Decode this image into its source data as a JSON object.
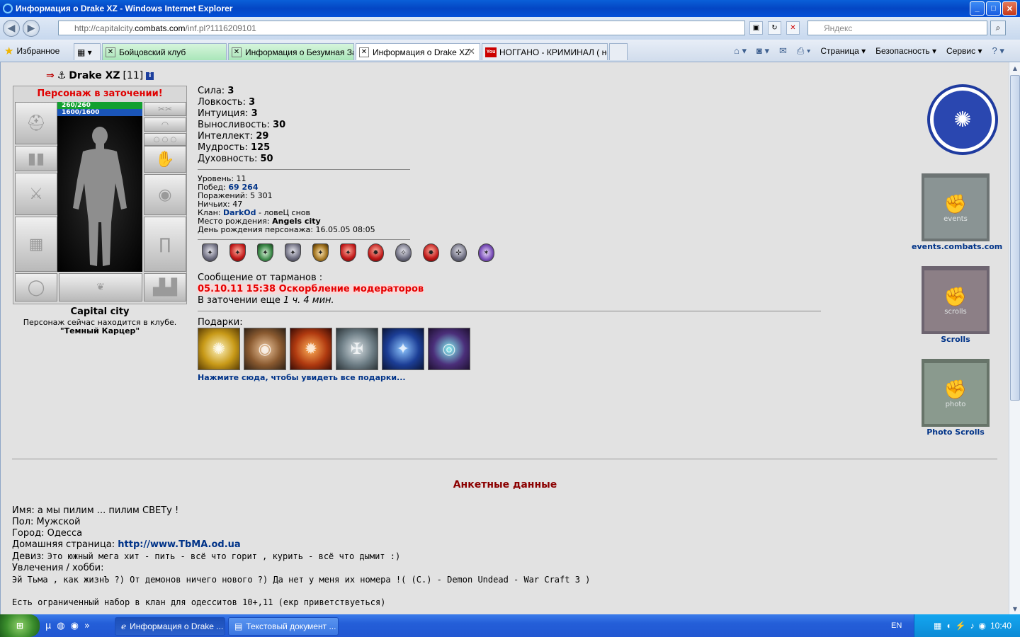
{
  "window": {
    "title": "Информация о Drake XZ - Windows Internet Explorer"
  },
  "address": {
    "url_prefix": "http://capitalcity.",
    "url_domain": "combats.com",
    "url_suffix": "/inf.pl?1116209101",
    "search_placeholder": "Яндекс"
  },
  "favorites_label": "Избранное",
  "tabs": [
    {
      "label": "Бойцовский клуб"
    },
    {
      "label": "Информация о Безумная Зая"
    },
    {
      "label": "Информация о Drake XZ"
    },
    {
      "label": "НОГГАНО - КРИМИНАЛ ( не..."
    }
  ],
  "commands": {
    "page": "Страница",
    "safety": "Безопасность",
    "service": "Сервис"
  },
  "character": {
    "name": "Drake XZ",
    "level_tag": "[11]",
    "prison_notice": "Персонаж в заточении!",
    "hp": "260/260",
    "mana": "1600/1600",
    "city": "Capital city",
    "location_note": "Персонаж сейчас находится в клубе.",
    "room": "\"Темный Карцер\""
  },
  "stats": [
    {
      "label": "Сила:",
      "value": "3"
    },
    {
      "label": "Ловкость:",
      "value": "3"
    },
    {
      "label": "Интуиция:",
      "value": "3"
    },
    {
      "label": "Выносливость:",
      "value": "30"
    },
    {
      "label": "Интеллект:",
      "value": "29"
    },
    {
      "label": "Мудрость:",
      "value": "125"
    },
    {
      "label": "Духовность:",
      "value": "50"
    }
  ],
  "info": {
    "level": "Уровень: 11",
    "wins_label": "Побед:",
    "wins": "69 264",
    "losses": "Поражений: 5 301",
    "draws": "Ничьих: 47",
    "clan_label": "Клан:",
    "clan": "DarkOd",
    "clan_rank": "- ловеЦ снов",
    "birthplace_label": "Место рождения:",
    "birthplace": "Angels city",
    "birthday": "День рождения персонажа: 16.05.05 08:05"
  },
  "message": {
    "title": "Сообщение от тарманов :",
    "text": "05.10.11 15:38 Оскорбление модераторов",
    "jail_prefix": "В заточении еще",
    "jail_time": "1 ч. 4 мин."
  },
  "gifts": {
    "label": "Подарки:",
    "link": "Нажмите сюда, чтобы увидеть все подарки..."
  },
  "sidebar": {
    "events_banner": "events",
    "events_link": "events.combats.com",
    "scrolls_banner": "scrolls",
    "scrolls_link": "Scrolls",
    "photo_banner": "photo",
    "photo_link": "Photo Scrolls"
  },
  "profile": {
    "heading": "Анкетные данные",
    "name": "Имя: а мы пилим ... пилим СВЕТу !",
    "gender": "Пол: Мужской",
    "city": "Город: Одесса",
    "homepage_label": "Домашняя страница:",
    "homepage": "http://www.TbMA.od.ua",
    "motto_label": "Девиз:",
    "motto": "Это южный мега хит - пить - всё что горит , курить - всё что дымит :)",
    "hobby_label": "Увлечения / хобби:",
    "hobby_1": "Эй Тьма , как жизнЪ ?) От демонов ничего нового ?) Да нет у меня их номера !( (С.)  -  Demon Undead - War Craft 3 )",
    "hobby_2": "Есть ограниченный набор в клан для одесситов 10+,11 (екр приветствуеться)"
  },
  "taskbar": {
    "task1": "Информация о Drake ...",
    "task2": "Текстовый документ ...",
    "lang": "EN",
    "time": "10:40"
  }
}
